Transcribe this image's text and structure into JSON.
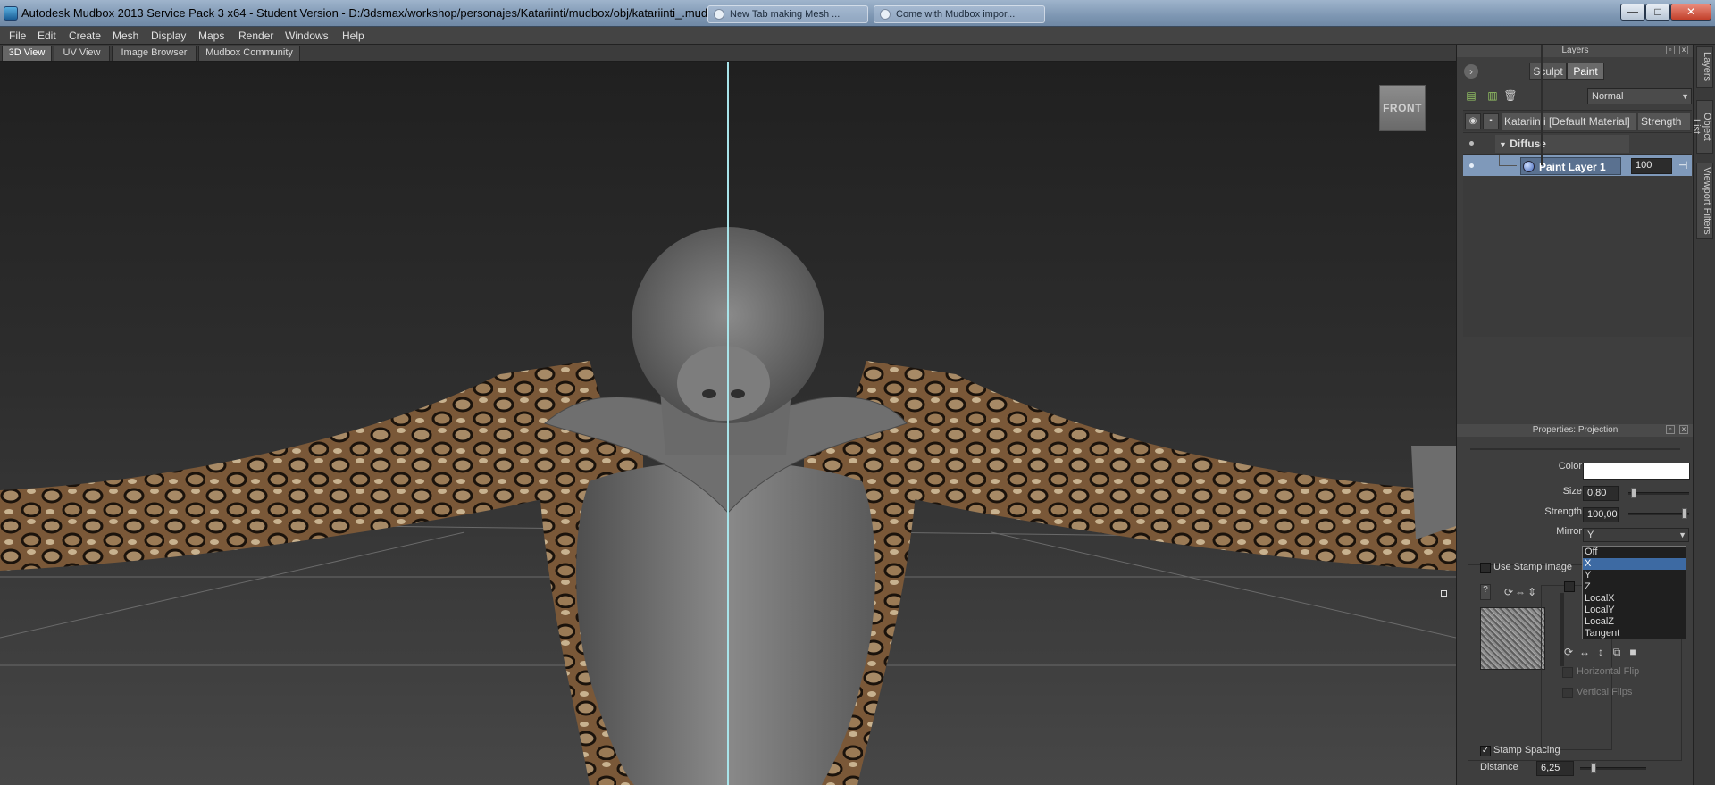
{
  "window": {
    "title": "Autodesk Mudbox 2013 Service Pack 3 x64 - Student Version - D:/3dsmax/workshop/personajes/Katariinti/mudbox/obj/katariinti_.mud",
    "bg_tabs": [
      "New Tab making Mesh ...",
      "Come with Mudbox impor..."
    ],
    "buttons": {
      "minimize": "—",
      "maximize": "□",
      "close": "✕"
    }
  },
  "menu": [
    "File",
    "Edit",
    "Create",
    "Mesh",
    "Display",
    "Maps",
    "Render",
    "Windows",
    "Help"
  ],
  "tabs": [
    {
      "label": "3D View",
      "active": true
    },
    {
      "label": "UV View",
      "active": false
    },
    {
      "label": "Image Browser",
      "active": false
    },
    {
      "label": "Mudbox Community",
      "active": false
    }
  ],
  "viewport": {
    "navcube_label": "FRONT"
  },
  "side_tabs": [
    "Layers",
    "Object List",
    "Viewport Filters"
  ],
  "layers": {
    "header": "Layers",
    "sculpt_label": "Sculpt",
    "paint_label": "Paint",
    "active_mode": "Paint",
    "blend_mode": "Normal",
    "material_label": "Katariinti [Default Material]",
    "strength_header": "Strength",
    "channel_label": "Diffuse",
    "paint_layer_name": "Paint Layer 1",
    "paint_layer_strength": "100"
  },
  "properties": {
    "header": "Properties: Projection",
    "color_label": "Color",
    "color_value": "#ffffff",
    "size_label": "Size",
    "size_value": "0,80",
    "strength_label": "Strength",
    "strength_value": "100,00",
    "mirror_label": "Mirror",
    "mirror_value": "Y",
    "mirror_options": [
      "Off",
      "X",
      "Y",
      "Z",
      "LocalX",
      "LocalY",
      "LocalZ",
      "Tangent"
    ],
    "mirror_highlighted": "X",
    "use_stamp_image_label": "Use Stamp Image",
    "horizontal_flip_label": "Horizontal Flip",
    "vertical_flip_label": "Vertical Flips",
    "stamp_spacing_label": "Stamp Spacing",
    "stamp_spacing_checked": true,
    "distance_label": "Distance",
    "distance_value": "6,25"
  },
  "colors": {
    "symmetry_line": "#a8e4ea",
    "selected_layer": "#7f99ba",
    "dropdown_highlight": "#3d6aa3"
  },
  "icons": [
    "app-icon",
    "close-circle-icon",
    "new-layer-icon",
    "duplicate-layer-icon",
    "trash-icon",
    "eye-icon",
    "lock-icon",
    "expand-triangle-icon",
    "paint-layer-icon",
    "help-icon",
    "rotate-icon",
    "flip-icon"
  ]
}
